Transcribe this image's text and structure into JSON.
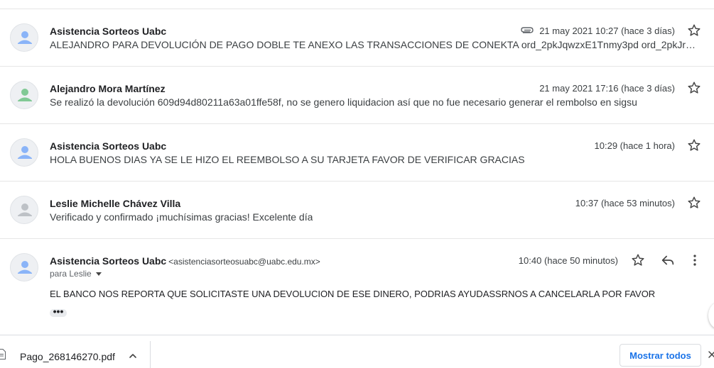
{
  "messages": [
    {
      "sender": "Asistencia Sorteos Uabc",
      "snippet": "ALEJANDRO PARA DEVOLUCIÓN DE PAGO DOBLE TE ANEXO LAS TRANSACCIONES DE CONEKTA ord_2pkJqwzxE1Tnmy3pd ord_2pkJrb6bBqu...",
      "date": "21 may 2021 10:27 (hace 3 días)",
      "has_attachment": true,
      "avatar_color": "#8ab4f8"
    },
    {
      "sender": "Alejandro Mora Martínez",
      "snippet": "Se realizó la devolución 609d94d80211a63a01ffe58f, no se genero liquidacion así que no fue necesario generar el rembolso en sigsu",
      "date": "21 may 2021 17:16 (hace 3 días)",
      "has_attachment": false,
      "avatar_color": "#81c995"
    },
    {
      "sender": "Asistencia Sorteos Uabc",
      "snippet": "HOLA BUENOS DIAS YA SE LE HIZO EL REEMBOLSO A SU TARJETA FAVOR DE VERIFICAR GRACIAS",
      "date": "10:29 (hace 1 hora)",
      "has_attachment": false,
      "avatar_color": "#8ab4f8"
    },
    {
      "sender": "Leslie Michelle Chávez Villa",
      "snippet": "Verificado y confirmado ¡muchísimas gracias! Excelente día",
      "date": "10:37 (hace 53 minutos)",
      "has_attachment": false,
      "avatar_color": "#bdc1c6"
    }
  ],
  "open_message": {
    "sender": "Asistencia Sorteos Uabc",
    "sender_email": "<asistenciasorteosuabc@uabc.edu.mx>",
    "to": "para Leslie",
    "date": "10:40 (hace 50 minutos)",
    "body": "EL BANCO NOS REPORTA QUE SOLICITASTE UNA DEVOLUCION DE ESE DINERO, PODRIAS AYUDASSRNOS A CANCELARLA POR FAVOR",
    "ellipsis": "•••",
    "avatar_color": "#8ab4f8"
  },
  "download_bar": {
    "file_name": "Pago_268146270.pdf",
    "show_all_label": "Mostrar todos"
  },
  "icons": {
    "star": "star-outline-icon",
    "reply": "reply-icon",
    "more": "more-vertical-icon",
    "attachment": "paperclip-icon"
  },
  "colors": {
    "link_blue": "#1a73e8",
    "divider": "#e6e6e6"
  }
}
